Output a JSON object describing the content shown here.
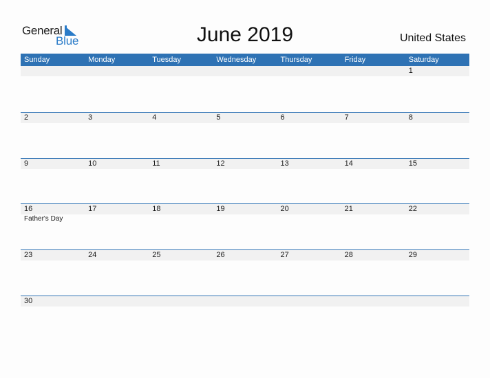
{
  "logo": {
    "line1": "General",
    "line2": "Blue"
  },
  "title": "June 2019",
  "country": "United States",
  "colors": {
    "accent": "#2e72b4",
    "logo_blue": "#2a7bc8",
    "date_strip": "#f1f1f1"
  },
  "weekdays": [
    "Sunday",
    "Monday",
    "Tuesday",
    "Wednesday",
    "Thursday",
    "Friday",
    "Saturday"
  ],
  "weeks": [
    {
      "days": [
        "",
        "",
        "",
        "",
        "",
        "",
        "1"
      ],
      "events": [
        "",
        "",
        "",
        "",
        "",
        "",
        ""
      ]
    },
    {
      "days": [
        "2",
        "3",
        "4",
        "5",
        "6",
        "7",
        "8"
      ],
      "events": [
        "",
        "",
        "",
        "",
        "",
        "",
        ""
      ]
    },
    {
      "days": [
        "9",
        "10",
        "11",
        "12",
        "13",
        "14",
        "15"
      ],
      "events": [
        "",
        "",
        "",
        "",
        "",
        "",
        ""
      ]
    },
    {
      "days": [
        "16",
        "17",
        "18",
        "19",
        "20",
        "21",
        "22"
      ],
      "events": [
        "Father's Day",
        "",
        "",
        "",
        "",
        "",
        ""
      ]
    },
    {
      "days": [
        "23",
        "24",
        "25",
        "26",
        "27",
        "28",
        "29"
      ],
      "events": [
        "",
        "",
        "",
        "",
        "",
        "",
        ""
      ]
    },
    {
      "days": [
        "30",
        "",
        "",
        "",
        "",
        "",
        ""
      ],
      "events": [
        "",
        "",
        "",
        "",
        "",
        "",
        ""
      ]
    }
  ]
}
